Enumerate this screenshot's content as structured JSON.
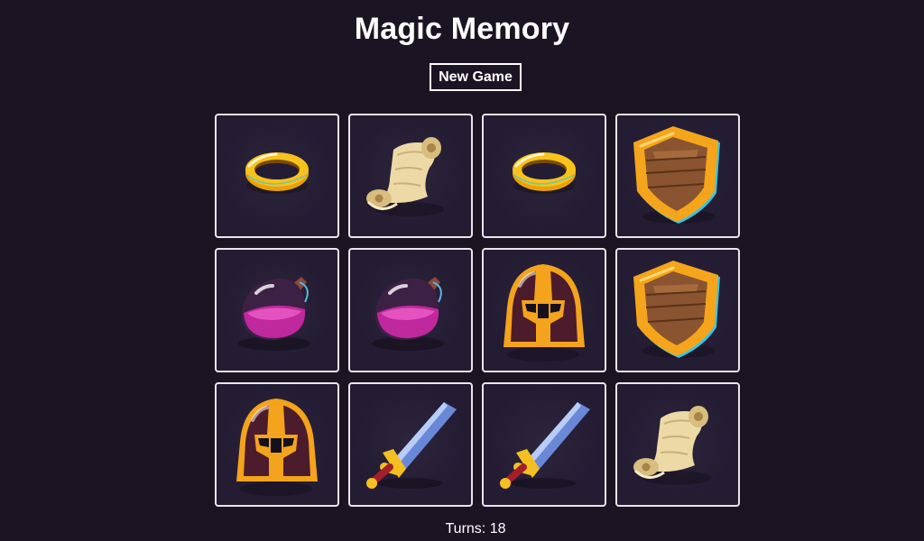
{
  "title": "Magic Memory",
  "new_game_label": "New Game",
  "turns_label": "Turns: 18",
  "cards": [
    {
      "icon": "ring-icon"
    },
    {
      "icon": "scroll-icon"
    },
    {
      "icon": "ring-icon"
    },
    {
      "icon": "shield-icon"
    },
    {
      "icon": "potion-icon"
    },
    {
      "icon": "potion-icon"
    },
    {
      "icon": "helmet-icon"
    },
    {
      "icon": "shield-icon"
    },
    {
      "icon": "helmet-icon"
    },
    {
      "icon": "sword-icon"
    },
    {
      "icon": "sword-icon"
    },
    {
      "icon": "scroll-icon"
    }
  ],
  "colors": {
    "background": "#1b1523",
    "card_background": "#241c33",
    "card_border": "#e9e6ef"
  }
}
